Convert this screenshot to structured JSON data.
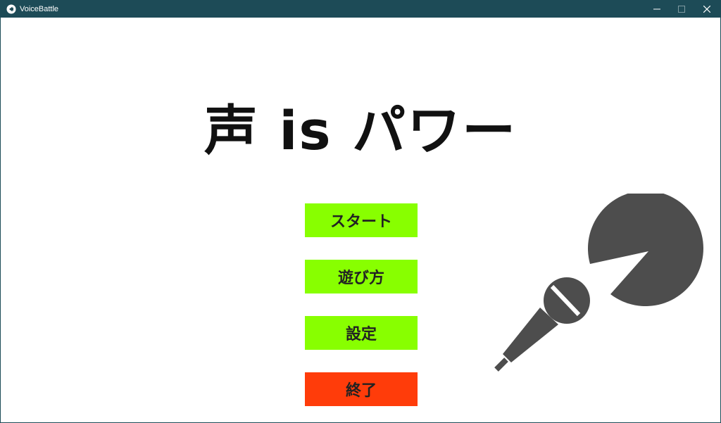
{
  "window": {
    "title": "VoiceBattle",
    "minimize_icon": "minimize-icon",
    "maximize_icon": "maximize-icon",
    "close_icon": "close-icon"
  },
  "title_screen": {
    "title": "声 is パワー"
  },
  "menu": {
    "start_label": "スタート",
    "howto_label": "遊び方",
    "settings_label": "設定",
    "exit_label": "終了"
  },
  "colors": {
    "titlebar": "#1d4b57",
    "button_green": "#88ff00",
    "button_red": "#ff3c0a",
    "illustration": "#4d4d4d"
  },
  "illustration": {
    "icon": "microphone-icon"
  }
}
